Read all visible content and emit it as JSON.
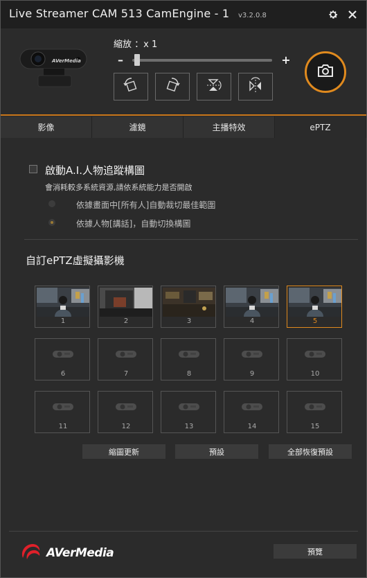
{
  "window": {
    "title": "Live Streamer CAM 513 CamEngine - 1",
    "version": "v3.2.0.8",
    "settings_icon": "gear-icon",
    "close_icon": "close-icon"
  },
  "zoom": {
    "label": "縮放 ：x 1",
    "minus": "–",
    "plus": "+",
    "level": 1
  },
  "tools": [
    {
      "icon": "rotate-left-icon"
    },
    {
      "icon": "rotate-right-icon"
    },
    {
      "icon": "flip-vertical-icon"
    },
    {
      "icon": "flip-horizontal-icon"
    }
  ],
  "snapshot_icon": "camera-icon",
  "tabs": [
    "影像",
    "濾鏡",
    "主播特效",
    "ePTZ"
  ],
  "active_tab": "ePTZ",
  "ai_tracking": {
    "label": "啟動A.I.人物追蹤構圖",
    "note": "會消耗較多系統資源,請依系統能力是否開啟",
    "checked": false,
    "options": [
      {
        "label": "依據畫面中[所有人]自動裁切最佳範圍",
        "selected": false
      },
      {
        "label": "依據人物[講話]，自動切換構圖",
        "selected": true
      }
    ]
  },
  "virtual_cams": {
    "title": "自訂ePTZ虛擬攝影機",
    "active": 5,
    "slots": [
      "1",
      "2",
      "3",
      "4",
      "5",
      "6",
      "7",
      "8",
      "9",
      "10",
      "11",
      "12",
      "13",
      "14",
      "15"
    ]
  },
  "actions": {
    "refresh": "縮圖更新",
    "default": "預設",
    "reset_all": "全部恢復預設"
  },
  "footer": {
    "brand": "AVerMedia",
    "preview": "預覽"
  },
  "colors": {
    "accent": "#e08a1e",
    "background": "#2b2b2b",
    "titlebar": "#1f1f1f"
  }
}
